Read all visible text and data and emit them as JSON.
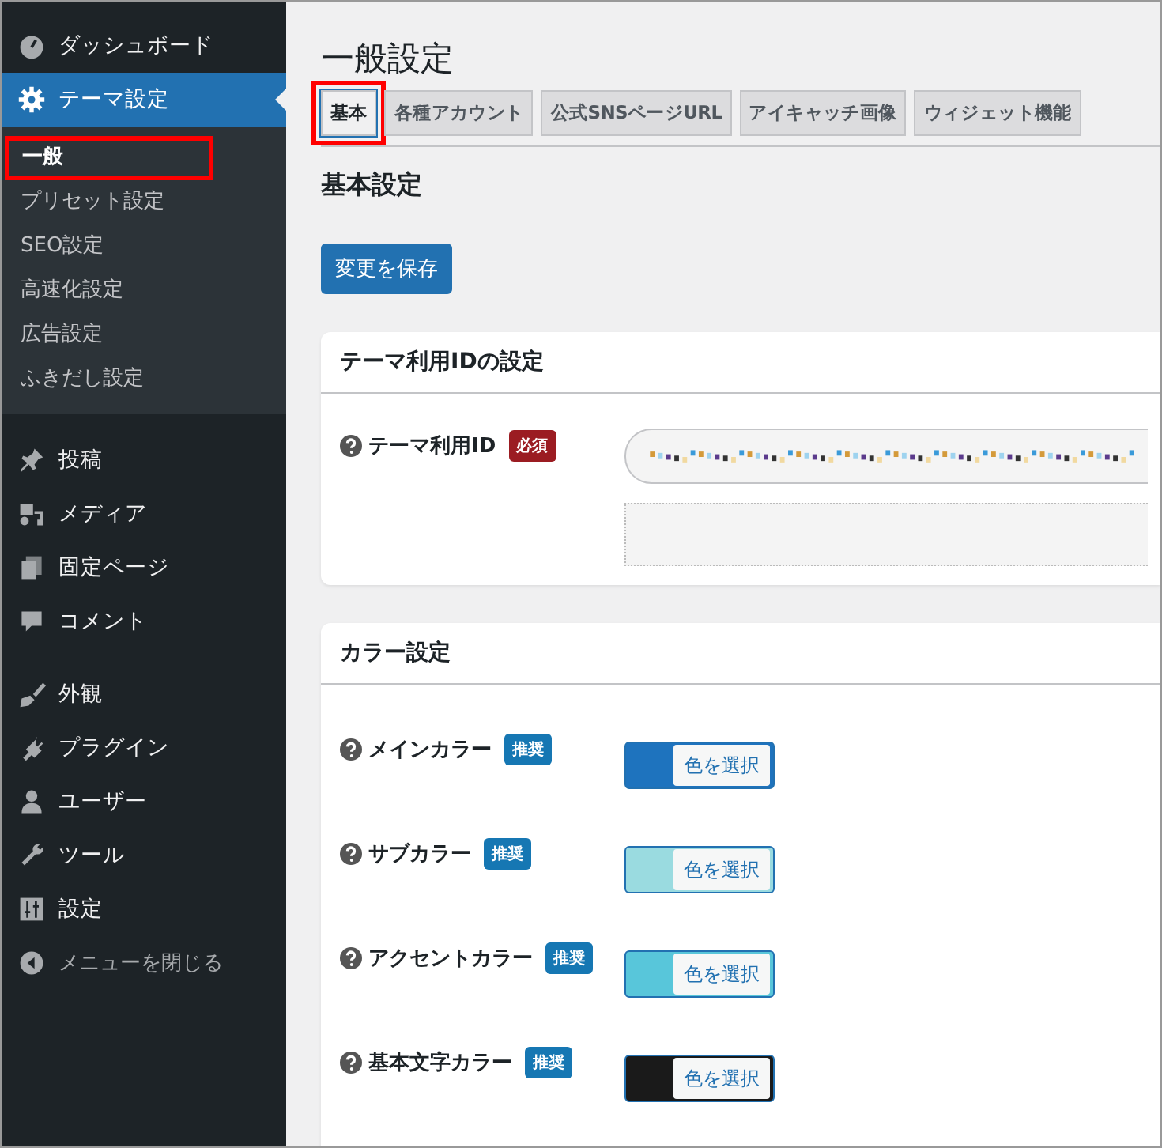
{
  "sidebar": {
    "items": [
      {
        "label": "ダッシュボード",
        "selected": false
      },
      {
        "label": "テーマ設定",
        "selected": true,
        "children": [
          {
            "label": "一般",
            "selected": true,
            "highlighted": true
          },
          {
            "label": "プリセット設定",
            "selected": false,
            "highlighted": false
          },
          {
            "label": "SEO設定",
            "selected": false,
            "highlighted": false
          },
          {
            "label": "高速化設定",
            "selected": false,
            "highlighted": false
          },
          {
            "label": "広告設定",
            "selected": false,
            "highlighted": false
          },
          {
            "label": "ふきだし設定",
            "selected": false,
            "highlighted": false
          }
        ]
      },
      {
        "label": "投稿",
        "selected": false
      },
      {
        "label": "メディア",
        "selected": false
      },
      {
        "label": "固定ページ",
        "selected": false
      },
      {
        "label": "コメント",
        "selected": false
      },
      {
        "label": "外観",
        "selected": false
      },
      {
        "label": "プラグイン",
        "selected": false
      },
      {
        "label": "ユーザー",
        "selected": false
      },
      {
        "label": "ツール",
        "selected": false
      },
      {
        "label": "設定",
        "selected": false
      },
      {
        "label": "メニューを閉じる",
        "selected": false
      }
    ]
  },
  "page_title": "一般設定",
  "tabs": [
    {
      "label": "基本",
      "selected": true,
      "highlighted": true
    },
    {
      "label": "各種アカウント",
      "selected": false,
      "highlighted": false
    },
    {
      "label": "公式SNSページURL",
      "selected": false,
      "highlighted": false
    },
    {
      "label": "アイキャッチ画像",
      "selected": false,
      "highlighted": false
    },
    {
      "label": "ウィジェット機能",
      "selected": false,
      "highlighted": false
    }
  ],
  "section_title": "基本設定",
  "save_button": "変更を保存",
  "id_card": {
    "title": "テーマ利用IDの設定",
    "label": "テーマ利用ID",
    "badge": "必須"
  },
  "color_card": {
    "title": "カラー設定",
    "rows": [
      {
        "label": "メインカラー",
        "badge": "推奨",
        "color": "#1e73be",
        "button": "色を選択"
      },
      {
        "label": "サブカラー",
        "badge": "推奨",
        "color": "#9adbe0",
        "button": "色を選択"
      },
      {
        "label": "アクセントカラー",
        "badge": "推奨",
        "color": "#58c6da",
        "button": "色を選択"
      },
      {
        "label": "基本文字カラー",
        "badge": "推奨",
        "color": "#1a1a1a",
        "button": "色を選択"
      }
    ]
  }
}
